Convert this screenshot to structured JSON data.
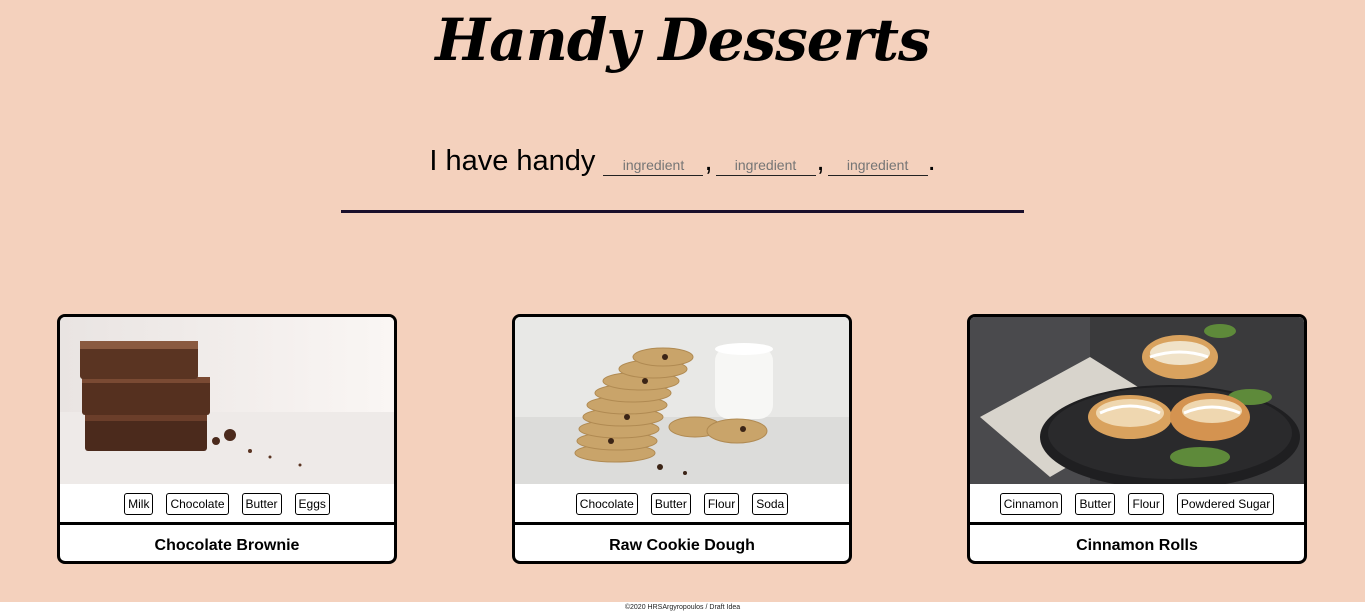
{
  "header": {
    "title": "Handy Desserts"
  },
  "search": {
    "prefix": "I have handy",
    "placeholder": "ingredient",
    "separator": ",",
    "suffix": "."
  },
  "recipes": [
    {
      "name": "Chocolate Brownie",
      "ingredients": [
        "Milk",
        "Chocolate",
        "Butter",
        "Eggs"
      ],
      "image": "brownie-photo"
    },
    {
      "name": "Raw Cookie Dough",
      "ingredients": [
        "Chocolate",
        "Butter",
        "Flour",
        "Soda"
      ],
      "image": "cookies-photo"
    },
    {
      "name": "Cinnamon Rolls",
      "ingredients": [
        "Cinnamon",
        "Butter",
        "Flour",
        "Powdered Sugar"
      ],
      "image": "cinnamon-rolls-photo"
    }
  ],
  "footer": {
    "text": "©2020 HRSArgyropoulos / Draft Idea"
  },
  "colors": {
    "background": "#f4d1bd",
    "divider": "#1a0f2b",
    "card_border": "#000000"
  }
}
